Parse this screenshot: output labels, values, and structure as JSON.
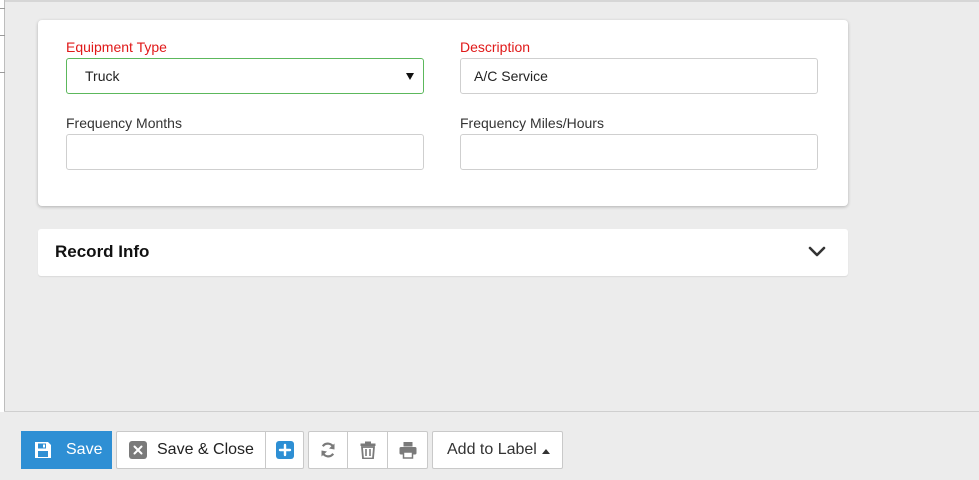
{
  "form": {
    "equipment_type": {
      "label": "Equipment Type",
      "value": "Truck"
    },
    "description": {
      "label": "Description",
      "value": "A/C Service"
    },
    "frequency_months": {
      "label": "Frequency Months",
      "value": ""
    },
    "frequency_miles_hours": {
      "label": "Frequency Miles/Hours",
      "value": ""
    }
  },
  "record_info": {
    "title": "Record Info"
  },
  "toolbar": {
    "save_label": "Save",
    "save_close_label": "Save & Close",
    "add_to_label": "Add to Label"
  },
  "colors": {
    "required_label": "#e01919",
    "primary_button": "#2e8fd4",
    "select_border": "#5cb85c"
  },
  "icons": [
    "save-icon",
    "close-x-icon",
    "plus-icon",
    "refresh-icon",
    "trash-icon",
    "print-icon",
    "chevron-down-icon",
    "caret-up-icon",
    "caret-down-icon"
  ]
}
